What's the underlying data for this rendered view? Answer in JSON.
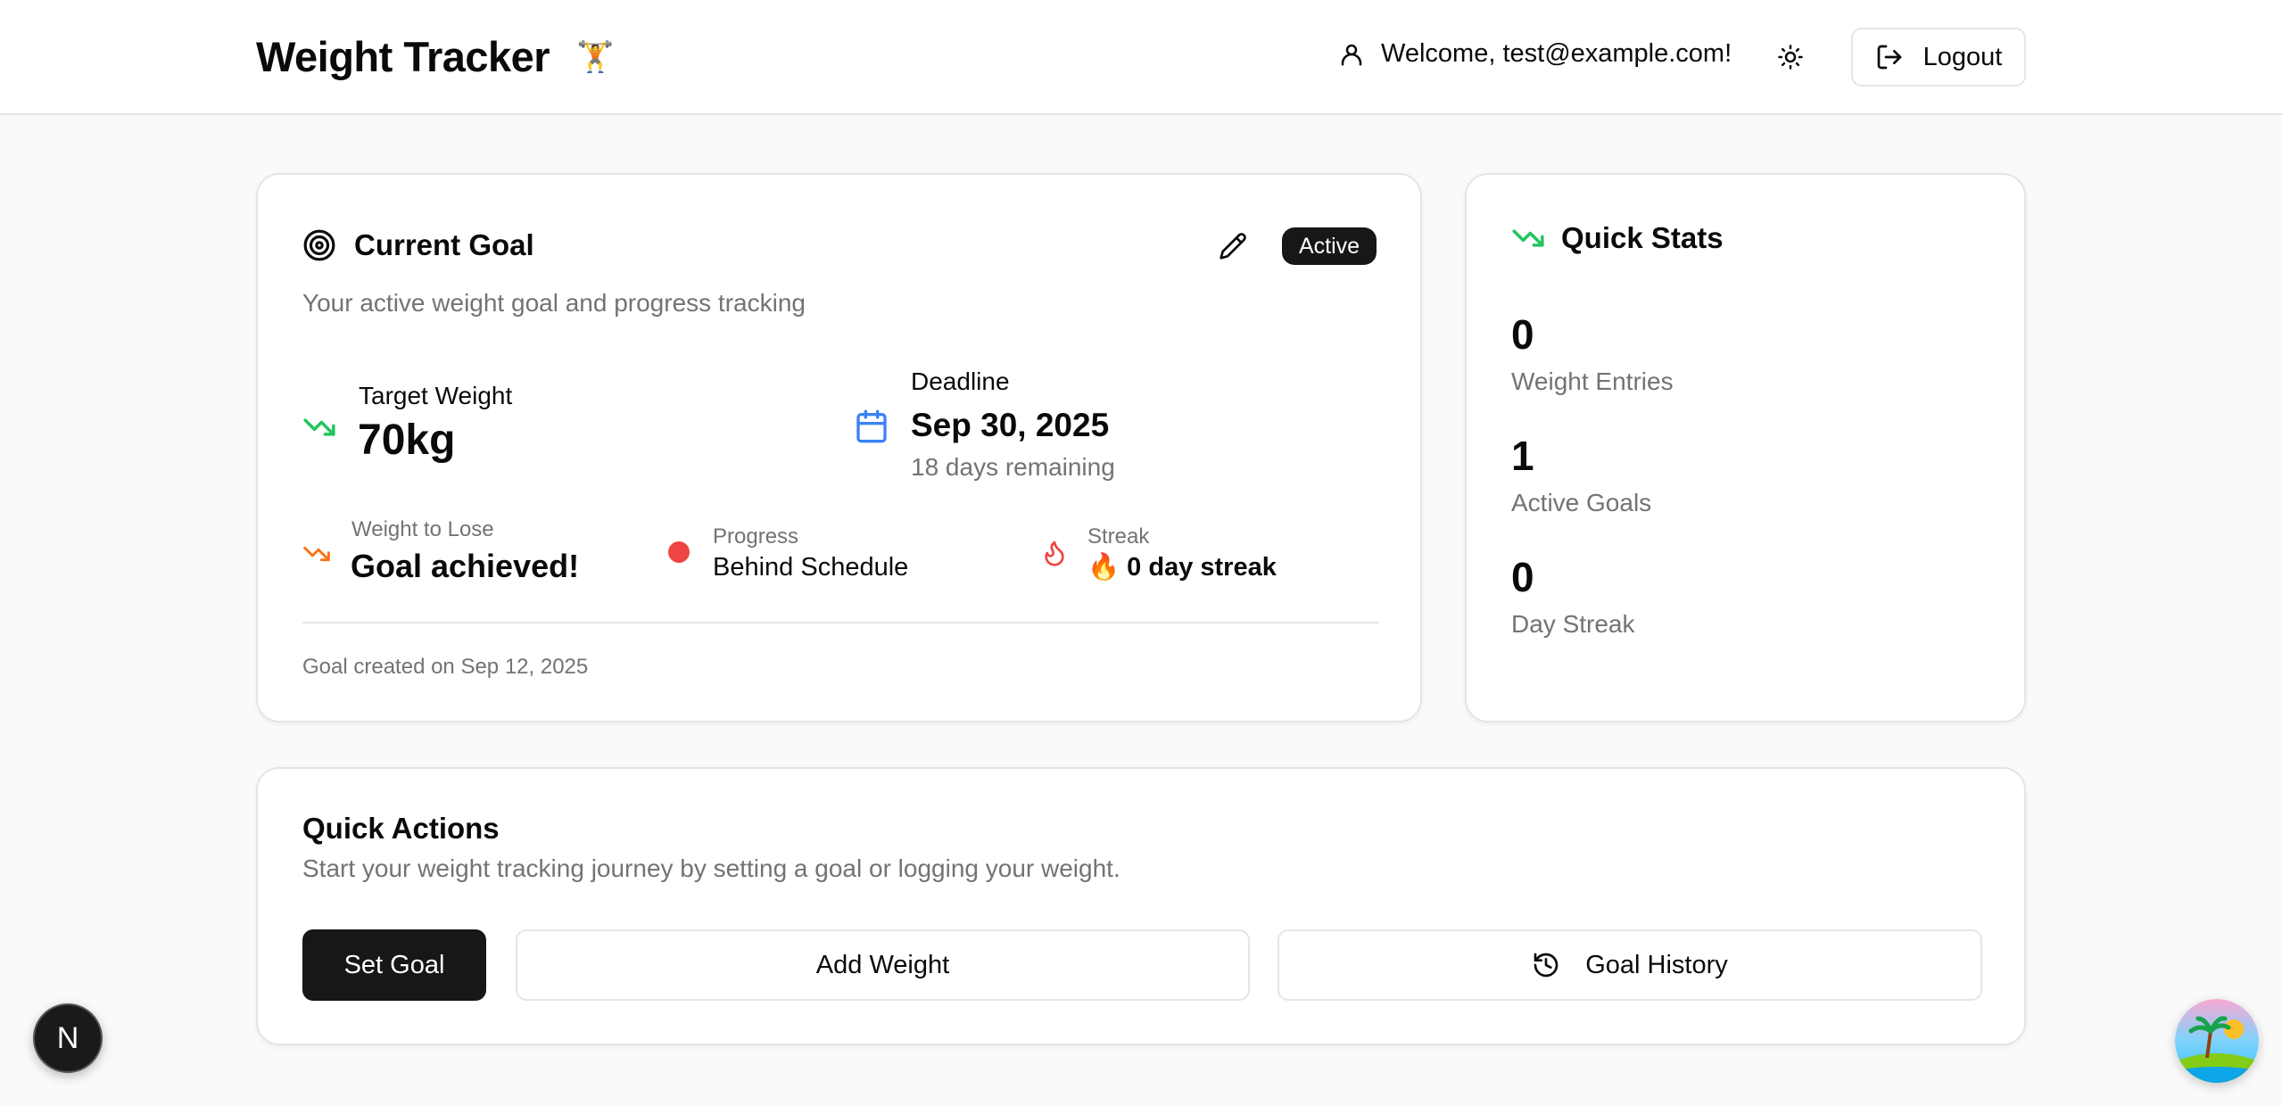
{
  "header": {
    "title": "Weight Tracker",
    "emoji": "🏋️",
    "welcome": "Welcome, test@example.com!",
    "logout_label": "Logout"
  },
  "goal_card": {
    "title": "Current Goal",
    "status_badge": "Active",
    "description": "Your active weight goal and progress tracking",
    "target_weight_label": "Target Weight",
    "target_weight_value": "70kg",
    "deadline_label": "Deadline",
    "deadline_value": "Sep 30, 2025",
    "deadline_remaining": "18 days remaining",
    "weight_to_lose_label": "Weight to Lose",
    "weight_to_lose_value": "Goal achieved!",
    "progress_label": "Progress",
    "progress_value": "Behind Schedule",
    "streak_label": "Streak",
    "streak_value": "🔥 0 day streak",
    "created": "Goal created on Sep 12, 2025"
  },
  "quick_stats": {
    "title": "Quick Stats",
    "items": [
      {
        "value": "0",
        "label": "Weight Entries"
      },
      {
        "value": "1",
        "label": "Active Goals"
      },
      {
        "value": "0",
        "label": "Day Streak"
      }
    ]
  },
  "quick_actions": {
    "title": "Quick Actions",
    "description": "Start your weight tracking journey by setting a goal or logging your weight.",
    "set_goal_label": "Set Goal",
    "add_weight_label": "Add Weight",
    "goal_history_label": "Goal History"
  },
  "dev_badge": "N",
  "colors": {
    "green": "#22c55e",
    "orange": "#f97316",
    "red": "#ef4444",
    "blue": "#3b82f6",
    "dark": "#171717"
  }
}
